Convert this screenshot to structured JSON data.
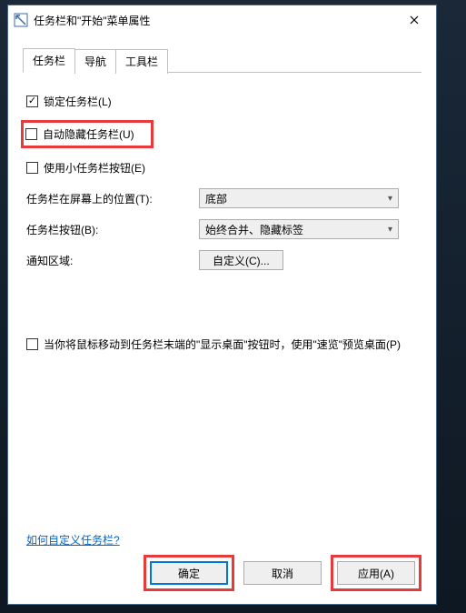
{
  "window": {
    "title": "任务栏和\"开始\"菜单属性"
  },
  "tabs": {
    "t0": "任务栏",
    "t1": "导航",
    "t2": "工具栏"
  },
  "checkboxes": {
    "lock_label": "锁定任务栏(L)",
    "autohide_label": "自动隐藏任务栏(U)",
    "smallbtn_label": "使用小任务栏按钮(E)",
    "peek_label": "当你将鼠标移动到任务栏末端的\"显示桌面\"按钮时，使用\"速览\"预览桌面(P)"
  },
  "form": {
    "location_label": "任务栏在屏幕上的位置(T):",
    "location_value": "底部",
    "buttons_label": "任务栏按钮(B):",
    "buttons_value": "始终合并、隐藏标签",
    "notify_label": "通知区域:",
    "notify_btn": "自定义(C)..."
  },
  "link": {
    "customize": "如何自定义任务栏?"
  },
  "buttons": {
    "ok": "确定",
    "cancel": "取消",
    "apply": "应用(A)"
  }
}
